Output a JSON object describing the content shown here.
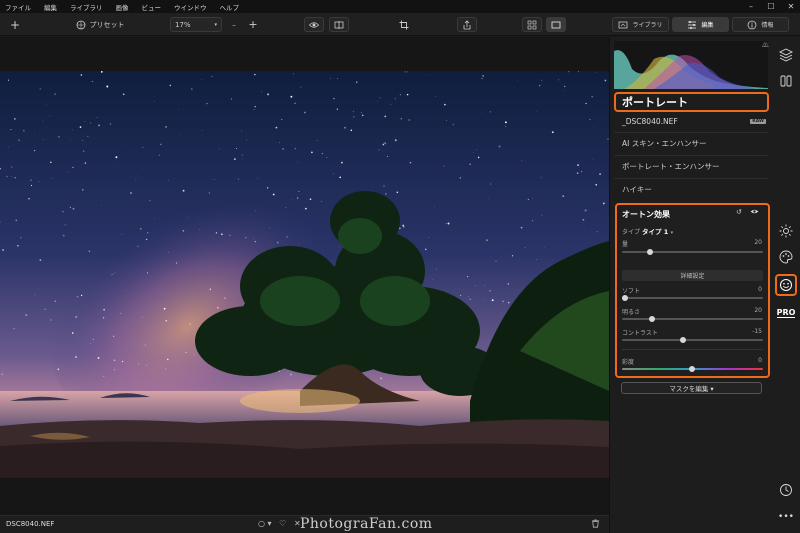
{
  "menu": {
    "items": [
      "ファイル",
      "編集",
      "ライブラリ",
      "画像",
      "ビュー",
      "ウインドウ",
      "ヘルプ"
    ],
    "window_controls": [
      "–",
      "☐",
      "✕"
    ]
  },
  "toolbar": {
    "add_label": "+",
    "presets_label": "プリセット",
    "zoom_value": "17%",
    "zoom_minus": "–",
    "zoom_plus": "+",
    "tabs": {
      "library": "ライブラリ",
      "edit": "編集",
      "info": "情報"
    }
  },
  "bottom": {
    "filename": "DSC8040.NEF",
    "rating_prefix": "○ ▾",
    "heart": "♡",
    "reject": "✕",
    "watermark": "PhotograFan.com"
  },
  "panel": {
    "title": "ポートレート",
    "file_name": "_DSC8040.NEF",
    "raw_badge": "RAW",
    "tools": [
      "AI スキン・エンハンサー",
      "ポートレート・エンハンサー",
      "ハイキー"
    ],
    "orton": {
      "title": "オートン効果",
      "type_label": "タイプ",
      "type_value": "タイプ 1",
      "amount_label": "量",
      "amount_value": "20",
      "amount": 20,
      "advanced_label": "詳細設定",
      "soft_label": "ソフト",
      "soft_value": "0",
      "brightness_label": "明るさ",
      "brightness_value": "20",
      "contrast_label": "コントラスト",
      "contrast_value": "-15",
      "saturation_label": "彩度",
      "saturation_value": "0"
    },
    "mask_button": "マスクを編集 ▾"
  },
  "colors": {
    "accent": "#ee6a1c",
    "panel_bg": "#1d1d1d",
    "sky_top": "#0e1c3c",
    "sky_glow": "#b77a9a"
  }
}
